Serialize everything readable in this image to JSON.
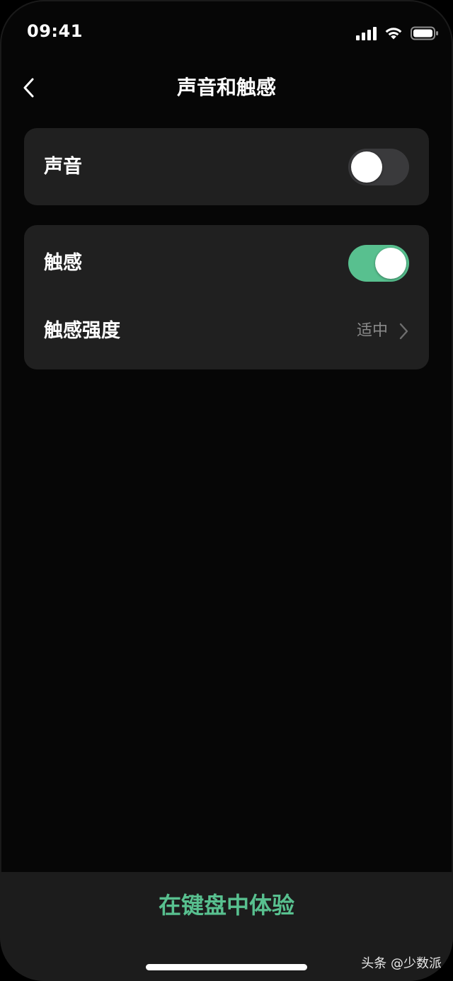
{
  "status_bar": {
    "time": "09:41",
    "icons": [
      "signal-icon",
      "wifi-icon",
      "battery-icon"
    ]
  },
  "nav": {
    "back_icon": "chevron-left-icon",
    "title": "声音和触感"
  },
  "sound_card": {
    "label": "声音",
    "toggle_on": false
  },
  "haptic_card": {
    "haptic_label": "触感",
    "haptic_toggle_on": true,
    "intensity_label": "触感强度",
    "intensity_value": "适中",
    "intensity_icon": "chevron-right-icon"
  },
  "bottom": {
    "try_label": "在键盘中体验"
  },
  "watermark": "头条 @少数派",
  "colors": {
    "accent_green": "#58c08f",
    "card_bg": "#202020",
    "toggle_off": "#3a3a3c",
    "secondary_text": "#8a8a8a"
  }
}
